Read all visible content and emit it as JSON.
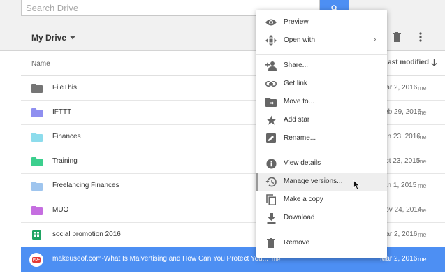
{
  "search": {
    "placeholder": "Search Drive"
  },
  "toolbar": {
    "title": "My Drive"
  },
  "list_header": {
    "name_label": "Name",
    "modified_label": "Last modified"
  },
  "files": [
    {
      "name": "FileThis",
      "date": "Mar 2, 2016",
      "owner": "me",
      "icon": "folder-icon",
      "color": "#757575"
    },
    {
      "name": "IFTTT",
      "date": "Feb 29, 2016",
      "owner": "me",
      "icon": "folder-icon",
      "color": "#8f8ff0"
    },
    {
      "name": "Finances",
      "date": "Jan 23, 2016",
      "owner": "me",
      "icon": "folder-icon",
      "color": "#8ddcec"
    },
    {
      "name": "Training",
      "date": "Oct 23, 2015",
      "owner": "me",
      "icon": "folder-icon",
      "color": "#3ccf8e"
    },
    {
      "name": "Freelancing Finances",
      "date": "Jan 1, 2015",
      "owner": "me",
      "icon": "folder-icon",
      "color": "#9fc5ee"
    },
    {
      "name": "MUO",
      "date": "Nov 24, 2014",
      "owner": "me",
      "icon": "folder-icon",
      "color": "#c56ee0"
    },
    {
      "name": "social promotion 2016",
      "date": "Mar 2, 2016",
      "owner": "me",
      "icon": "sheets-icon",
      "color": "#1fa463"
    },
    {
      "name": "makeuseof.com-What Is Malvertising and How Can You Protect You...",
      "date": "Mar 2, 2016",
      "owner": "me",
      "owner_mid": "me",
      "icon": "pdf-icon",
      "color": "#e53935",
      "selected": true
    }
  ],
  "context_menu": {
    "items": [
      {
        "label": "Preview",
        "icon": "eye-icon"
      },
      {
        "label": "Open with",
        "icon": "open-with-icon",
        "submenu": "›"
      },
      {
        "label": "Share...",
        "icon": "add-person-icon"
      },
      {
        "label": "Get link",
        "icon": "link-icon"
      },
      {
        "label": "Move to...",
        "icon": "move-folder-icon"
      },
      {
        "label": "Add star",
        "icon": "star-icon"
      },
      {
        "label": "Rename...",
        "icon": "rename-icon"
      },
      {
        "label": "View details",
        "icon": "info-icon"
      },
      {
        "label": "Manage versions...",
        "icon": "history-icon",
        "active": true
      },
      {
        "label": "Make a copy",
        "icon": "copy-icon"
      },
      {
        "label": "Download",
        "icon": "download-icon"
      },
      {
        "label": "Remove",
        "icon": "trash-icon"
      }
    ]
  },
  "colors": {
    "accent": "#4d8ff3",
    "toolbar_bg": "#f1f1f1",
    "icon_gray": "#757575"
  }
}
